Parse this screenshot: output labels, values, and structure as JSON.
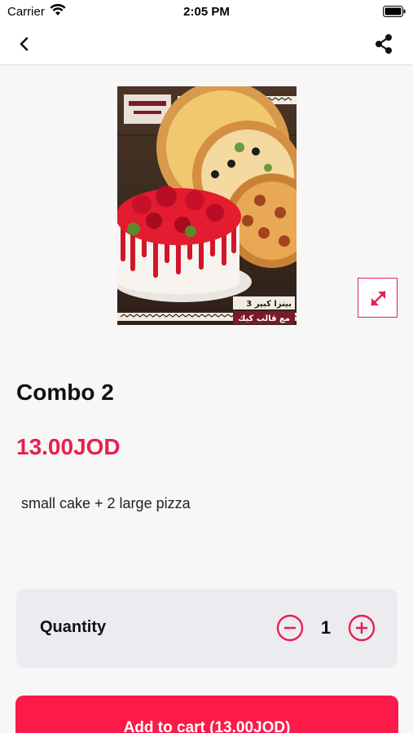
{
  "status_bar": {
    "carrier": "Carrier",
    "time": "2:05 PM"
  },
  "nav": {
    "back_icon": "chevron-left-icon",
    "share_icon": "share-icon"
  },
  "product": {
    "image_text": {
      "line1": "3 بيتزا كبير",
      "line2": "مع قالب كيك"
    },
    "title": "Combo 2",
    "price": "13.00JOD",
    "description": "small cake + 2 large pizza"
  },
  "quantity": {
    "label": "Quantity",
    "value": "1"
  },
  "cart": {
    "button_label": "Add to cart (13.00JOD)"
  },
  "colors": {
    "accent": "#e8204f",
    "button": "#fb1a48",
    "background": "#f7f7f8"
  }
}
